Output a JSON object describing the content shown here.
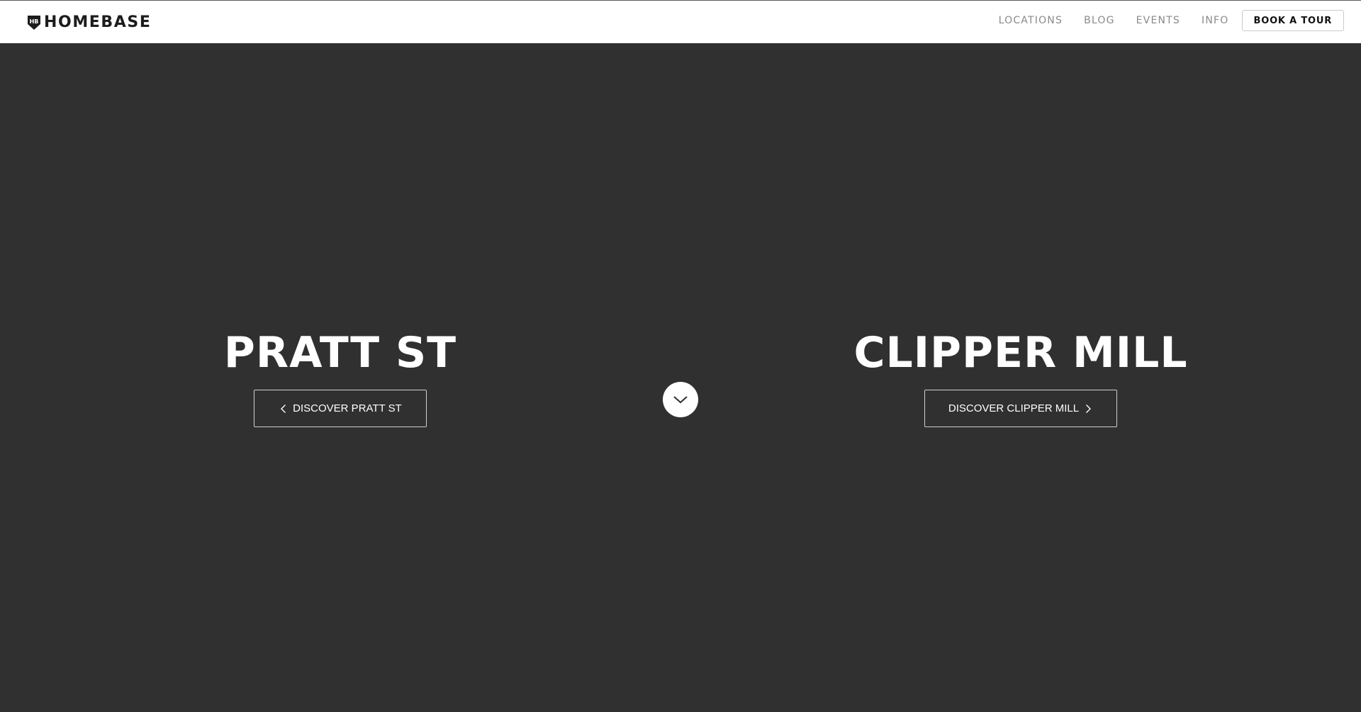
{
  "header": {
    "logo_text": "HOMEBASE",
    "logo_mark_text": "HB",
    "nav": [
      {
        "label": "LOCATIONS"
      },
      {
        "label": "BLOG"
      },
      {
        "label": "EVENTS"
      },
      {
        "label": "INFO"
      }
    ],
    "cta_label": "BOOK A TOUR"
  },
  "hero": {
    "left": {
      "title": "PRATT ST",
      "button_label": "DISCOVER PRATT ST",
      "button_icon": "chevron-left-icon"
    },
    "right": {
      "title": "CLIPPER MILL",
      "button_label": "DISCOVER CLIPPER MILL",
      "button_icon": "chevron-right-icon"
    },
    "scroll_icon": "chevron-down-icon"
  },
  "colors": {
    "background": "#303030",
    "header_background": "#ffffff",
    "text_on_dark": "#ffffff",
    "nav_text": "#8a8a8a"
  }
}
